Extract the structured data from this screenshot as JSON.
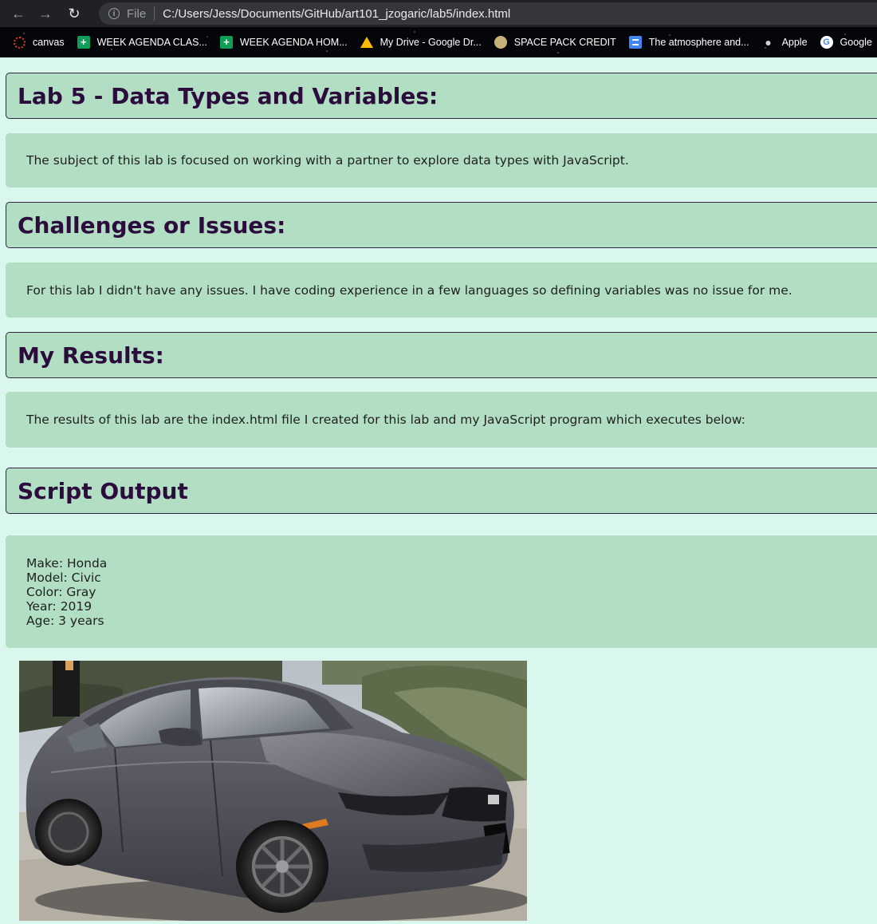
{
  "browser": {
    "file_label": "File",
    "url": "C:/Users/Jess/Documents/GitHub/art101_jzogaric/lab5/index.html",
    "bookmarks": [
      {
        "label": "canvas",
        "icon": "canvas-icon"
      },
      {
        "label": "WEEK AGENDA CLAS...",
        "icon": "sheets-icon"
      },
      {
        "label": "WEEK AGENDA HOM...",
        "icon": "sheets-icon"
      },
      {
        "label": "My Drive - Google Dr...",
        "icon": "drive-icon"
      },
      {
        "label": "SPACE PACK CREDIT",
        "icon": "space-pack-icon"
      },
      {
        "label": "The atmosphere and...",
        "icon": "docs-icon"
      },
      {
        "label": "Apple",
        "icon": "apple-icon"
      },
      {
        "label": "Google",
        "icon": "google-icon"
      }
    ]
  },
  "sections": {
    "intro": {
      "heading": "Lab 5 - Data Types and Variables:",
      "text": "The subject of this lab is focused on working with a partner to explore data types with JavaScript."
    },
    "challenges": {
      "heading": "Challenges or Issues:",
      "text": "For this lab I didn't have any issues. I have coding experience in a few languages so defining variables was no issue for me."
    },
    "results": {
      "heading": "My Results:",
      "text": "The results of this lab are the index.html file I created for this lab and my JavaScript program which executes below:"
    },
    "output": {
      "heading": "Script Output",
      "lines": [
        "Make: Honda",
        "Model: Civic",
        "Color: Gray",
        "Year: 2019",
        "Age: 3 years"
      ]
    }
  },
  "colors": {
    "page_background": "#daf7ee",
    "card_background": "#b2dfc3",
    "heading_text": "#2c0b3d",
    "card_border": "#2f2540"
  }
}
